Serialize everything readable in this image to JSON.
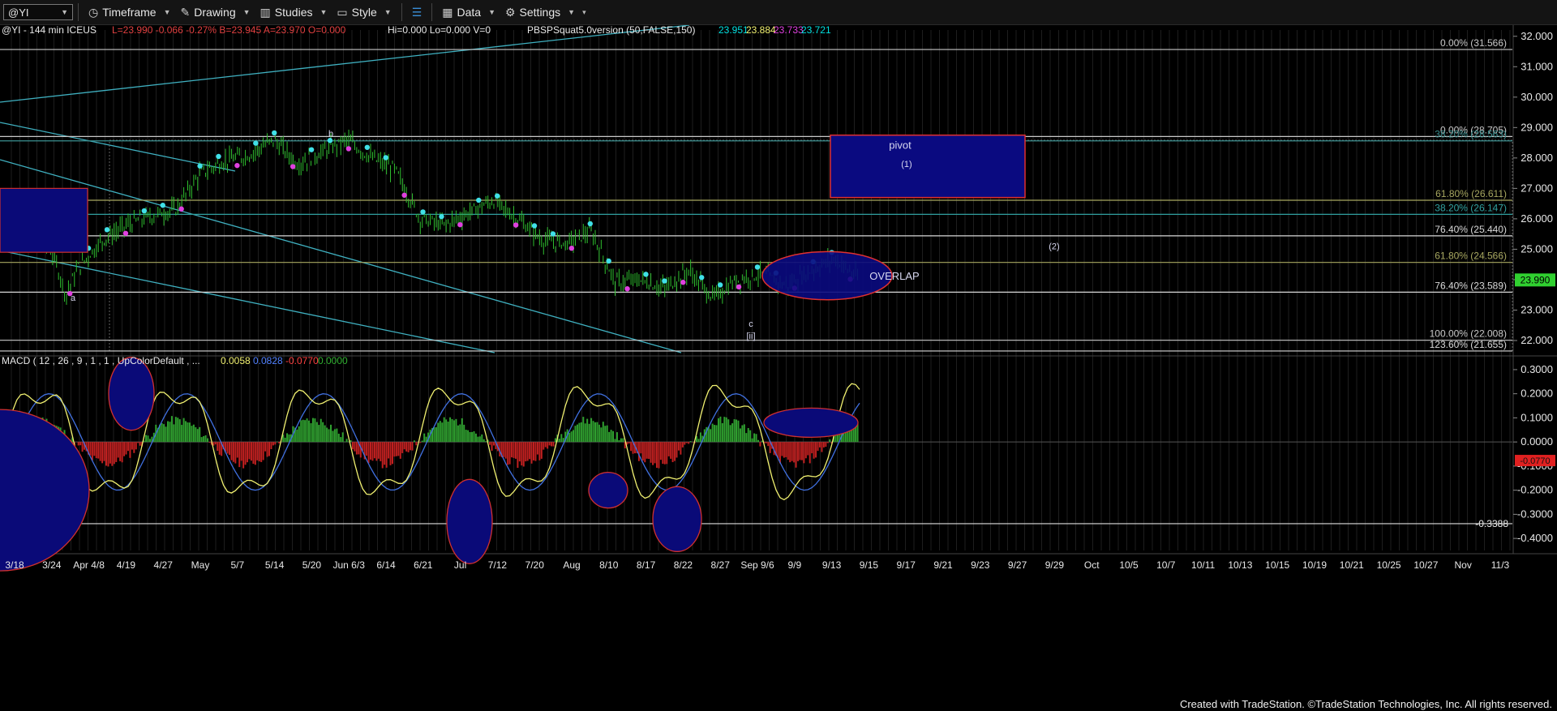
{
  "toolbar": {
    "symbol": "@YI",
    "timeframe": "Timeframe",
    "drawing": "Drawing",
    "studies": "Studies",
    "style": "Style",
    "data": "Data",
    "settings": "Settings"
  },
  "header": {
    "symbol_info": "@YI - 144 min  ICEUS",
    "quote": "L=23.990  -0.066  -0.27%  B=23.945  A=23.970  O=0.000",
    "hilo": "Hi=0.000   Lo=0.000   V=0",
    "study": "PBSPSquat5.0version (50,FALSE,150)",
    "study_values": [
      "23.951",
      "23.884",
      "23.733",
      "23.721"
    ],
    "study_colors": [
      "#00e0e0",
      "#f0f070",
      "#e040e0",
      "#00e0e0"
    ]
  },
  "macd_header": {
    "label": "MACD ( 12 , 26 , 9 , 1 , 1 , UpColorDefault , ...",
    "values": [
      "0.0058",
      "0.0828",
      "-0.0770",
      "0.0000"
    ],
    "colors": [
      "#f0f070",
      "#5080ff",
      "#ff4040",
      "#30b030"
    ]
  },
  "chart_data": [
    {
      "type": "ohlc",
      "title": "@YI - 144 min ICEUS",
      "y_axis_ticks": [
        "32.000",
        "31.000",
        "30.000",
        "29.000",
        "28.000",
        "27.000",
        "26.000",
        "25.000",
        "24.000",
        "23.000",
        "22.000"
      ],
      "ylim": [
        21.6,
        32.1
      ],
      "last_price": "23.990",
      "x_tick_labels": [
        "3/18",
        "3/24",
        "Apr 4/8",
        "4/19",
        "4/27",
        "May",
        "5/7",
        "5/14",
        "5/20",
        "Jun 6/3",
        "6/14",
        "6/21",
        "Jul",
        "7/12",
        "7/20",
        "Aug",
        "8/10",
        "8/17",
        "8/22",
        "8/27",
        "Sep 9/6",
        "9/9",
        "9/13",
        "9/15",
        "9/17",
        "9/21",
        "9/23",
        "9/27",
        "9/29",
        "Oct",
        "10/5",
        "10/7",
        "10/11",
        "10/13",
        "10/15",
        "10/19",
        "10/21",
        "10/25",
        "10/27",
        "Nov",
        "11/3"
      ],
      "fib_levels": [
        {
          "label": "0.00% (31.566)",
          "value": 31.566,
          "color": "#c8c8c8"
        },
        {
          "label": "0.00% (28.705)",
          "value": 28.705,
          "color": "#c8c8c8"
        },
        {
          "label": "38.20% (28.563)",
          "value": 28.563,
          "color": "#3a8f8f"
        },
        {
          "label": "61.80% (26.611)",
          "value": 26.611,
          "color": "#a7a760"
        },
        {
          "label": "38.20% (26.147)",
          "value": 26.147,
          "color": "#30a0a0"
        },
        {
          "label": "76.40% (25.440)",
          "value": 25.44,
          "color": "#d8d8d8"
        },
        {
          "label": "61.80% (24.566)",
          "value": 24.566,
          "color": "#a7a760"
        },
        {
          "label": "76.40% (23.589)",
          "value": 23.589,
          "color": "#d8d8d8"
        },
        {
          "label": "100.00% (22.008)",
          "value": 22.008,
          "color": "#c8c8c8"
        },
        {
          "label": "123.60% (21.655)",
          "value": 21.655,
          "color": "#d8d8d8"
        }
      ],
      "annotations": [
        {
          "text": "a",
          "x": "3/28",
          "y": 23.3
        },
        {
          "text": "b",
          "x": "5/22",
          "y": 28.7
        },
        {
          "text": "c",
          "x": "8/21",
          "y": 22.45
        },
        {
          "text": "[ii]",
          "x": "8/21",
          "y": 22.05
        },
        {
          "text": "pivot",
          "x": "9/7",
          "y": 28.3
        },
        {
          "text": "(1)",
          "x": "9/8",
          "y": 27.7
        },
        {
          "text": "(2)",
          "x": "9/27",
          "y": 25.0
        },
        {
          "text": "OVERLAP",
          "x": "9/9",
          "y": 24.0
        }
      ],
      "price_path": [
        [
          0,
          26.4
        ],
        [
          0.02,
          26.0
        ],
        [
          0.04,
          24.8
        ],
        [
          0.05,
          23.5
        ],
        [
          0.06,
          24.4
        ],
        [
          0.08,
          25.3
        ],
        [
          0.1,
          25.8
        ],
        [
          0.12,
          26.1
        ],
        [
          0.14,
          26.3
        ],
        [
          0.16,
          27.5
        ],
        [
          0.18,
          27.9
        ],
        [
          0.2,
          28.1
        ],
        [
          0.22,
          28.6
        ],
        [
          0.24,
          27.8
        ],
        [
          0.26,
          28.2
        ],
        [
          0.28,
          28.6
        ],
        [
          0.3,
          28.0
        ],
        [
          0.32,
          27.6
        ],
        [
          0.34,
          26.0
        ],
        [
          0.36,
          25.8
        ],
        [
          0.38,
          26.2
        ],
        [
          0.4,
          26.6
        ],
        [
          0.42,
          26.0
        ],
        [
          0.44,
          25.3
        ],
        [
          0.46,
          25.2
        ],
        [
          0.48,
          25.6
        ],
        [
          0.5,
          23.9
        ],
        [
          0.52,
          24.0
        ],
        [
          0.54,
          23.7
        ],
        [
          0.56,
          24.3
        ],
        [
          0.58,
          23.4
        ],
        [
          0.6,
          24.0
        ],
        [
          0.62,
          24.2
        ],
        [
          0.64,
          23.8
        ],
        [
          0.66,
          24.3
        ],
        [
          0.68,
          24.7
        ],
        [
          0.7,
          24.0
        ]
      ]
    },
    {
      "type": "macd",
      "y_axis_ticks": [
        "0.3000",
        "0.2000",
        "0.1000",
        "0.0000",
        "-0.1000",
        "-0.2000",
        "-0.3000",
        "-0.4000"
      ],
      "ylim": [
        -0.45,
        0.33
      ],
      "level_line": "-0.3388",
      "last_value_label": "-0.0770"
    }
  ],
  "footer": "Created with TradeStation. ©TradeStation Technologies, Inc. All rights reserved."
}
